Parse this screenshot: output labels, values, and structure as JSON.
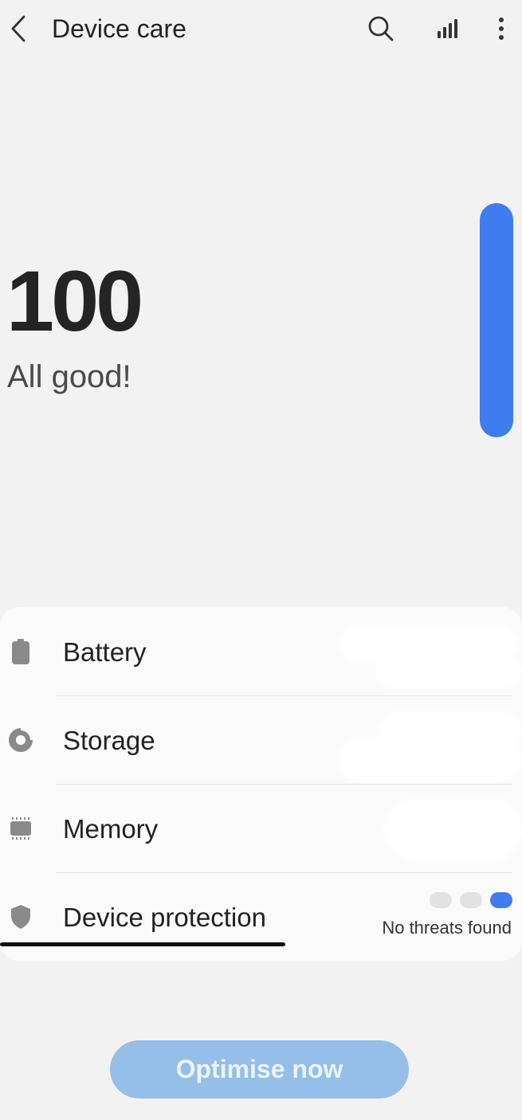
{
  "header": {
    "title": "Device care",
    "back_icon": "chevron-left-icon",
    "search_icon": "search-icon",
    "stats_icon": "signal-bars-icon",
    "more_icon": "more-vertical-icon"
  },
  "summary": {
    "score": "100",
    "status": "All good!"
  },
  "items": [
    {
      "label": "Battery",
      "icon": "battery-icon"
    },
    {
      "label": "Storage",
      "icon": "storage-pie-icon"
    },
    {
      "label": "Memory",
      "icon": "memory-chip-icon"
    },
    {
      "label": "Device protection",
      "icon": "shield-icon",
      "status": "No threats found"
    }
  ],
  "footer": {
    "optimise_label": "Optimise now"
  },
  "colors": {
    "accent": "#3e7cf0",
    "button_disabled": "#95bee8"
  }
}
